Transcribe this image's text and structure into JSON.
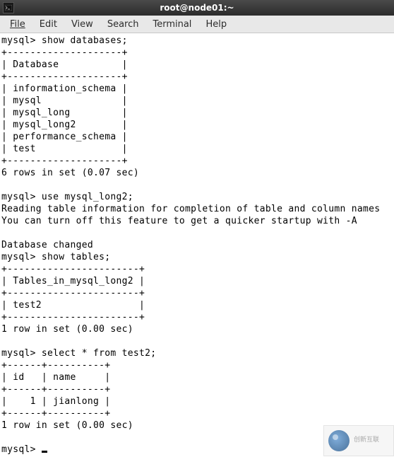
{
  "window": {
    "title": "root@node01:~"
  },
  "menubar": {
    "items": [
      "File",
      "Edit",
      "View",
      "Search",
      "Terminal",
      "Help"
    ]
  },
  "terminal": {
    "lines": [
      "mysql> show databases;",
      "+--------------------+",
      "| Database           |",
      "+--------------------+",
      "| information_schema |",
      "| mysql              |",
      "| mysql_long         |",
      "| mysql_long2        |",
      "| performance_schema |",
      "| test               |",
      "+--------------------+",
      "6 rows in set (0.07 sec)",
      "",
      "mysql> use mysql_long2;",
      "Reading table information for completion of table and column names",
      "You can turn off this feature to get a quicker startup with -A",
      "",
      "Database changed",
      "mysql> show tables;",
      "+-----------------------+",
      "| Tables_in_mysql_long2 |",
      "+-----------------------+",
      "| test2                 |",
      "+-----------------------+",
      "1 row in set (0.00 sec)",
      "",
      "mysql> select * from test2;",
      "+------+----------+",
      "| id   | name     |",
      "+------+----------+",
      "|    1 | jianlong |",
      "+------+----------+",
      "1 row in set (0.00 sec)",
      "",
      "mysql> "
    ]
  },
  "watermark": {
    "text": "创新互联"
  }
}
